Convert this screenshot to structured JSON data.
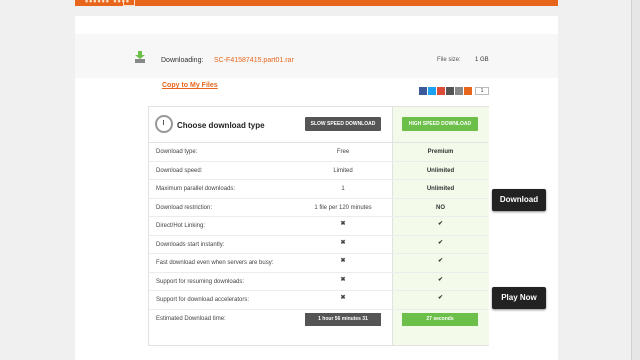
{
  "header": {
    "logo_text": "•••••• ••••"
  },
  "download": {
    "label": "Downloading:",
    "filename": "SC-F41587415.part01.rar",
    "size_label": "File size:",
    "size_value": "1 GB"
  },
  "copy_link": "Copy to My Files",
  "share": {
    "count": "1",
    "colors": [
      "#3b5998",
      "#1da1f2",
      "#dd4b39",
      "#555555",
      "#888888",
      "#e8661c"
    ]
  },
  "table": {
    "title": "Choose download type",
    "slow_button": "SLOW SPEED DOWNLOAD",
    "high_button": "HIGH SPEED DOWNLOAD",
    "rows": [
      {
        "label": "Download type:",
        "free": "Free",
        "premium": "Premium"
      },
      {
        "label": "Download speed:",
        "free": "Limited",
        "premium": "Unlimited"
      },
      {
        "label": "Maximum parallel downloads:",
        "free": "1",
        "premium": "Unlimited"
      },
      {
        "label": "Download restriction:",
        "free": "1 file per 120 minutes",
        "premium": "NO"
      },
      {
        "label": "Direct/Hot Linking:",
        "free": "✖",
        "premium": "✔"
      },
      {
        "label": "Downloads start instantly:",
        "free": "✖",
        "premium": "✔"
      },
      {
        "label": "Fast download even when servers are busy:",
        "free": "✖",
        "premium": "✔"
      },
      {
        "label": "Support for resuming downloads:",
        "free": "✖",
        "premium": "✔"
      },
      {
        "label": "Support for download accelerators:",
        "free": "✖",
        "premium": "✔"
      }
    ],
    "time_row": {
      "label": "Estimated Download time:",
      "free": "1 hour 56 minutes 31",
      "premium": "27 seconds"
    }
  },
  "side_buttons": {
    "download": "Download",
    "play": "Play Now"
  },
  "colors": {
    "accent": "#e8661c",
    "green": "#6cc04a",
    "dark": "#555555"
  }
}
